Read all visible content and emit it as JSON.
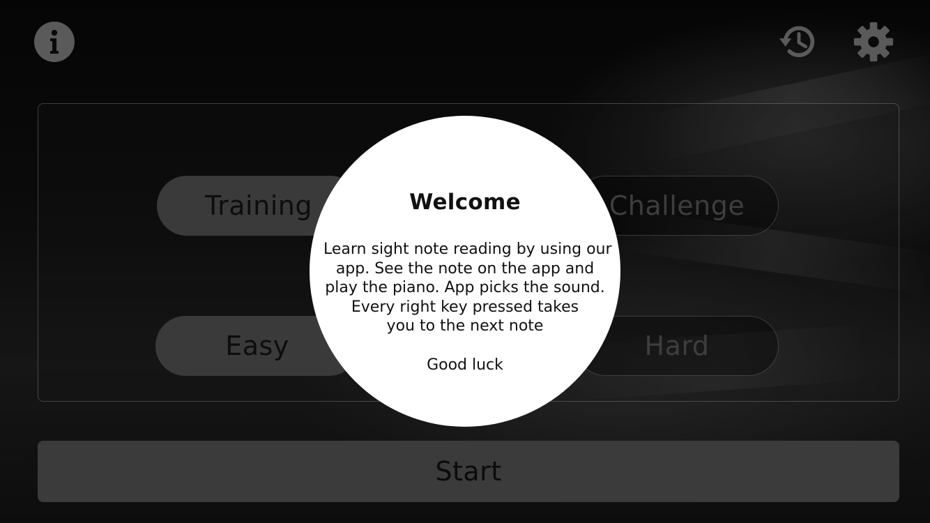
{
  "toolbar": {
    "info_icon": "info-icon",
    "history_icon": "history-icon",
    "settings_icon": "gear-icon"
  },
  "mode_options": {
    "training": {
      "label": "Training",
      "selected": true
    },
    "challenge": {
      "label": "Challenge",
      "selected": false
    }
  },
  "level_options": {
    "easy": {
      "label": "Easy",
      "selected": true
    },
    "hard": {
      "label": "Hard",
      "selected": false
    }
  },
  "start_button": {
    "label": "Start"
  },
  "welcome_dialog": {
    "title": "Welcome",
    "body_lines": [
      "Learn sight note reading by using our",
      "app. See the note on the app and",
      "play the piano. App picks the sound.",
      "Every right key pressed takes",
      "you to the next note"
    ],
    "footer": "Good luck"
  },
  "colors": {
    "dialog_background": "#ffffff",
    "selected_pill": "#3a3a3a",
    "start_button": "#3b3b3b",
    "icon_gray": "#5a5a5a"
  }
}
